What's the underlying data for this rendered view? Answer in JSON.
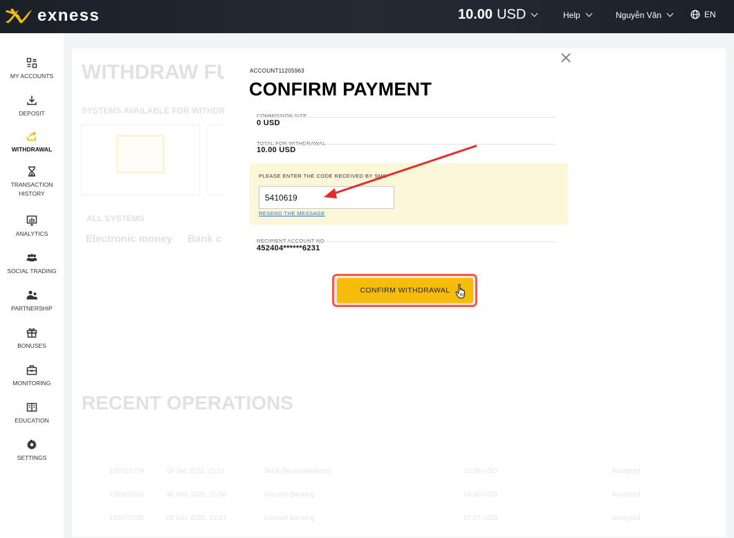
{
  "brand": {
    "name": "exness",
    "accent": "#f5bd0a"
  },
  "header": {
    "balance_amount": "10.00",
    "balance_currency": "USD",
    "help_label": "Help",
    "user_label": "Nguyễn Văn",
    "lang_label": "EN"
  },
  "sidebar": {
    "items": [
      {
        "label": "MY ACCOUNTS",
        "icon": "grid-icon"
      },
      {
        "label": "DEPOSIT",
        "icon": "download-icon"
      },
      {
        "label": "WITHDRAWAL",
        "icon": "upload-icon",
        "active": true
      },
      {
        "label": "TRANSACTION HISTORY",
        "icon": "hourglass-icon"
      },
      {
        "label": "ANALYTICS",
        "icon": "chart-icon"
      },
      {
        "label": "SOCIAL TRADING",
        "icon": "people-icon"
      },
      {
        "label": "PARTNERSHIP",
        "icon": "partner-icon"
      },
      {
        "label": "BONUSES",
        "icon": "gift-icon"
      },
      {
        "label": "MONITORING",
        "icon": "briefcase-icon"
      },
      {
        "label": "EDUCATION",
        "icon": "book-icon"
      },
      {
        "label": "SETTINGS",
        "icon": "gear-icon"
      }
    ]
  },
  "background": {
    "title": "WITHDRAW FU",
    "systems_label": "SYSTEMS AVAILABLE FOR WITHDR",
    "all_systems": "ALL SYSTEMS",
    "tab_electronic": "Electronic money",
    "tab_bank": "Bank c",
    "recent_title": "RECENT OPERATIONS",
    "rows": [
      {
        "id": "165016779",
        "date": "18 Jan 2021, 15:51",
        "type": "Skrill (Moneybookers)",
        "amount": "22.48 USD",
        "status": "Accepted"
      },
      {
        "id": "156905224",
        "date": "30 Nov 2020, 15:00",
        "type": "Internet Banking",
        "amount": "54.80 USD",
        "status": "Accepted"
      },
      {
        "id": "156670785",
        "date": "28 Nov 2020, 16:27",
        "type": "Internet Banking",
        "amount": "17.27 USD",
        "status": "Accepted"
      }
    ]
  },
  "modal": {
    "account": "ACCOUNT11205963",
    "title": "CONFIRM PAYMENT",
    "commission_label": "COMMISSION SIZE",
    "commission_value": "0 USD",
    "total_label": "TOTAL FOR WITHDRAWAL",
    "total_value": "10.00 USD",
    "sms_label": "PLEASE ENTER THE CODE RECEIVED BY SMS",
    "sms_code": "5410619",
    "resend_label": "RESEND THE MESSAGE",
    "recipient_label": "RECIPIENT ACCOUNT NO",
    "recipient_value": "452404******6231",
    "confirm_label": "CONFIRM WITHDRAWAL"
  }
}
